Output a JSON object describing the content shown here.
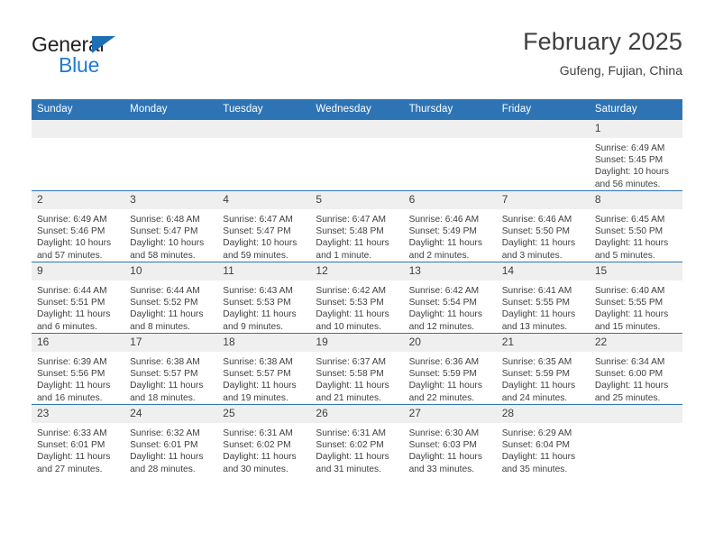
{
  "logo": {
    "word_top": "General",
    "word_bottom": "Blue",
    "triangle_color": "#1f6fb5",
    "blue_color": "#1f7ad4"
  },
  "header": {
    "title": "February 2025",
    "subtitle": "Gufeng, Fujian, China",
    "accent_color": "#2e74b5"
  },
  "weekdays": [
    "Sunday",
    "Monday",
    "Tuesday",
    "Wednesday",
    "Thursday",
    "Friday",
    "Saturday"
  ],
  "weeks": [
    [
      {
        "day": "",
        "sunrise": "",
        "sunset": "",
        "daylight_line1": "",
        "daylight_line2": ""
      },
      {
        "day": "",
        "sunrise": "",
        "sunset": "",
        "daylight_line1": "",
        "daylight_line2": ""
      },
      {
        "day": "",
        "sunrise": "",
        "sunset": "",
        "daylight_line1": "",
        "daylight_line2": ""
      },
      {
        "day": "",
        "sunrise": "",
        "sunset": "",
        "daylight_line1": "",
        "daylight_line2": ""
      },
      {
        "day": "",
        "sunrise": "",
        "sunset": "",
        "daylight_line1": "",
        "daylight_line2": ""
      },
      {
        "day": "",
        "sunrise": "",
        "sunset": "",
        "daylight_line1": "",
        "daylight_line2": ""
      },
      {
        "day": "1",
        "sunrise": "Sunrise: 6:49 AM",
        "sunset": "Sunset: 5:45 PM",
        "daylight_line1": "Daylight: 10 hours",
        "daylight_line2": "and 56 minutes."
      }
    ],
    [
      {
        "day": "2",
        "sunrise": "Sunrise: 6:49 AM",
        "sunset": "Sunset: 5:46 PM",
        "daylight_line1": "Daylight: 10 hours",
        "daylight_line2": "and 57 minutes."
      },
      {
        "day": "3",
        "sunrise": "Sunrise: 6:48 AM",
        "sunset": "Sunset: 5:47 PM",
        "daylight_line1": "Daylight: 10 hours",
        "daylight_line2": "and 58 minutes."
      },
      {
        "day": "4",
        "sunrise": "Sunrise: 6:47 AM",
        "sunset": "Sunset: 5:47 PM",
        "daylight_line1": "Daylight: 10 hours",
        "daylight_line2": "and 59 minutes."
      },
      {
        "day": "5",
        "sunrise": "Sunrise: 6:47 AM",
        "sunset": "Sunset: 5:48 PM",
        "daylight_line1": "Daylight: 11 hours",
        "daylight_line2": "and 1 minute."
      },
      {
        "day": "6",
        "sunrise": "Sunrise: 6:46 AM",
        "sunset": "Sunset: 5:49 PM",
        "daylight_line1": "Daylight: 11 hours",
        "daylight_line2": "and 2 minutes."
      },
      {
        "day": "7",
        "sunrise": "Sunrise: 6:46 AM",
        "sunset": "Sunset: 5:50 PM",
        "daylight_line1": "Daylight: 11 hours",
        "daylight_line2": "and 3 minutes."
      },
      {
        "day": "8",
        "sunrise": "Sunrise: 6:45 AM",
        "sunset": "Sunset: 5:50 PM",
        "daylight_line1": "Daylight: 11 hours",
        "daylight_line2": "and 5 minutes."
      }
    ],
    [
      {
        "day": "9",
        "sunrise": "Sunrise: 6:44 AM",
        "sunset": "Sunset: 5:51 PM",
        "daylight_line1": "Daylight: 11 hours",
        "daylight_line2": "and 6 minutes."
      },
      {
        "day": "10",
        "sunrise": "Sunrise: 6:44 AM",
        "sunset": "Sunset: 5:52 PM",
        "daylight_line1": "Daylight: 11 hours",
        "daylight_line2": "and 8 minutes."
      },
      {
        "day": "11",
        "sunrise": "Sunrise: 6:43 AM",
        "sunset": "Sunset: 5:53 PM",
        "daylight_line1": "Daylight: 11 hours",
        "daylight_line2": "and 9 minutes."
      },
      {
        "day": "12",
        "sunrise": "Sunrise: 6:42 AM",
        "sunset": "Sunset: 5:53 PM",
        "daylight_line1": "Daylight: 11 hours",
        "daylight_line2": "and 10 minutes."
      },
      {
        "day": "13",
        "sunrise": "Sunrise: 6:42 AM",
        "sunset": "Sunset: 5:54 PM",
        "daylight_line1": "Daylight: 11 hours",
        "daylight_line2": "and 12 minutes."
      },
      {
        "day": "14",
        "sunrise": "Sunrise: 6:41 AM",
        "sunset": "Sunset: 5:55 PM",
        "daylight_line1": "Daylight: 11 hours",
        "daylight_line2": "and 13 minutes."
      },
      {
        "day": "15",
        "sunrise": "Sunrise: 6:40 AM",
        "sunset": "Sunset: 5:55 PM",
        "daylight_line1": "Daylight: 11 hours",
        "daylight_line2": "and 15 minutes."
      }
    ],
    [
      {
        "day": "16",
        "sunrise": "Sunrise: 6:39 AM",
        "sunset": "Sunset: 5:56 PM",
        "daylight_line1": "Daylight: 11 hours",
        "daylight_line2": "and 16 minutes."
      },
      {
        "day": "17",
        "sunrise": "Sunrise: 6:38 AM",
        "sunset": "Sunset: 5:57 PM",
        "daylight_line1": "Daylight: 11 hours",
        "daylight_line2": "and 18 minutes."
      },
      {
        "day": "18",
        "sunrise": "Sunrise: 6:38 AM",
        "sunset": "Sunset: 5:57 PM",
        "daylight_line1": "Daylight: 11 hours",
        "daylight_line2": "and 19 minutes."
      },
      {
        "day": "19",
        "sunrise": "Sunrise: 6:37 AM",
        "sunset": "Sunset: 5:58 PM",
        "daylight_line1": "Daylight: 11 hours",
        "daylight_line2": "and 21 minutes."
      },
      {
        "day": "20",
        "sunrise": "Sunrise: 6:36 AM",
        "sunset": "Sunset: 5:59 PM",
        "daylight_line1": "Daylight: 11 hours",
        "daylight_line2": "and 22 minutes."
      },
      {
        "day": "21",
        "sunrise": "Sunrise: 6:35 AM",
        "sunset": "Sunset: 5:59 PM",
        "daylight_line1": "Daylight: 11 hours",
        "daylight_line2": "and 24 minutes."
      },
      {
        "day": "22",
        "sunrise": "Sunrise: 6:34 AM",
        "sunset": "Sunset: 6:00 PM",
        "daylight_line1": "Daylight: 11 hours",
        "daylight_line2": "and 25 minutes."
      }
    ],
    [
      {
        "day": "23",
        "sunrise": "Sunrise: 6:33 AM",
        "sunset": "Sunset: 6:01 PM",
        "daylight_line1": "Daylight: 11 hours",
        "daylight_line2": "and 27 minutes."
      },
      {
        "day": "24",
        "sunrise": "Sunrise: 6:32 AM",
        "sunset": "Sunset: 6:01 PM",
        "daylight_line1": "Daylight: 11 hours",
        "daylight_line2": "and 28 minutes."
      },
      {
        "day": "25",
        "sunrise": "Sunrise: 6:31 AM",
        "sunset": "Sunset: 6:02 PM",
        "daylight_line1": "Daylight: 11 hours",
        "daylight_line2": "and 30 minutes."
      },
      {
        "day": "26",
        "sunrise": "Sunrise: 6:31 AM",
        "sunset": "Sunset: 6:02 PM",
        "daylight_line1": "Daylight: 11 hours",
        "daylight_line2": "and 31 minutes."
      },
      {
        "day": "27",
        "sunrise": "Sunrise: 6:30 AM",
        "sunset": "Sunset: 6:03 PM",
        "daylight_line1": "Daylight: 11 hours",
        "daylight_line2": "and 33 minutes."
      },
      {
        "day": "28",
        "sunrise": "Sunrise: 6:29 AM",
        "sunset": "Sunset: 6:04 PM",
        "daylight_line1": "Daylight: 11 hours",
        "daylight_line2": "and 35 minutes."
      },
      {
        "day": "",
        "sunrise": "",
        "sunset": "",
        "daylight_line1": "",
        "daylight_line2": ""
      }
    ]
  ]
}
